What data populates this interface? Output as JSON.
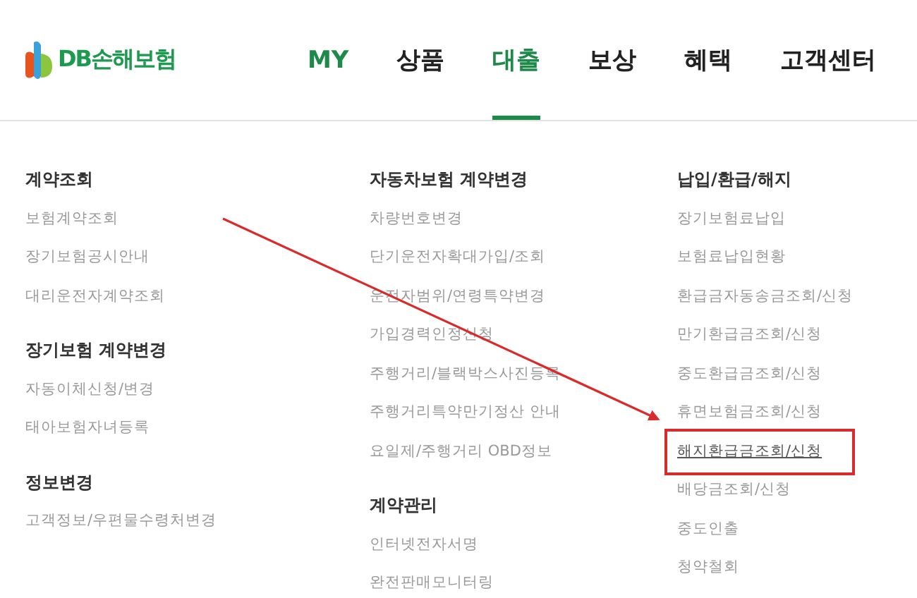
{
  "logo": {
    "text": "DB손해보험"
  },
  "nav": [
    {
      "label": "MY",
      "kind": "account",
      "selected": false
    },
    {
      "label": "상품",
      "kind": "menu",
      "selected": false
    },
    {
      "label": "대출",
      "kind": "menu",
      "selected": true
    },
    {
      "label": "보상",
      "kind": "menu",
      "selected": false
    },
    {
      "label": "혜택",
      "kind": "menu",
      "selected": false
    },
    {
      "label": "고객센터",
      "kind": "menu",
      "selected": false
    }
  ],
  "columns": [
    {
      "groups": [
        {
          "title": "계약조회",
          "items": [
            {
              "label": "보험계약조회",
              "selected": false
            },
            {
              "label": "장기보험공시안내",
              "selected": false
            },
            {
              "label": "대리운전자계약조회",
              "selected": false
            }
          ]
        },
        {
          "title": "장기보험 계약변경",
          "items": [
            {
              "label": "자동이체신청/변경",
              "selected": false
            },
            {
              "label": "태아보험자녀등록",
              "selected": false
            }
          ]
        },
        {
          "title": "정보변경",
          "items": [
            {
              "label": "고객정보/우편물수령처변경",
              "selected": false
            }
          ]
        }
      ]
    },
    {
      "groups": [
        {
          "title": "자동차보험 계약변경",
          "items": [
            {
              "label": "차량번호변경",
              "selected": false
            },
            {
              "label": "단기운전자확대가입/조회",
              "selected": false
            },
            {
              "label": "운전자범위/연령특약변경",
              "selected": false
            },
            {
              "label": "가입경력인정신청",
              "selected": false
            },
            {
              "label": "주행거리/블랙박스사진등록",
              "selected": false
            },
            {
              "label": "주행거리특약만기정산 안내",
              "selected": false
            },
            {
              "label": "요일제/주행거리 OBD정보",
              "selected": false
            }
          ]
        },
        {
          "title": "계약관리",
          "items": [
            {
              "label": "인터넷전자서명",
              "selected": false
            },
            {
              "label": "완전판매모니터링",
              "selected": false
            }
          ]
        }
      ]
    },
    {
      "groups": [
        {
          "title": "납입/환급/해지",
          "items": [
            {
              "label": "장기보험료납입",
              "selected": false
            },
            {
              "label": "보험료납입현황",
              "selected": false
            },
            {
              "label": "환급금자동송금조회/신청",
              "selected": false
            },
            {
              "label": "만기환급금조회/신청",
              "selected": false
            },
            {
              "label": "중도환급금조회/신청",
              "selected": false
            },
            {
              "label": "휴면보험금조회/신청",
              "selected": false
            },
            {
              "label": "해지환급금조회/신청",
              "selected": true
            },
            {
              "label": "배당금조회/신청",
              "selected": false
            },
            {
              "label": "중도인출",
              "selected": false
            },
            {
              "label": "청약철회",
              "selected": false
            }
          ]
        }
      ]
    }
  ]
}
